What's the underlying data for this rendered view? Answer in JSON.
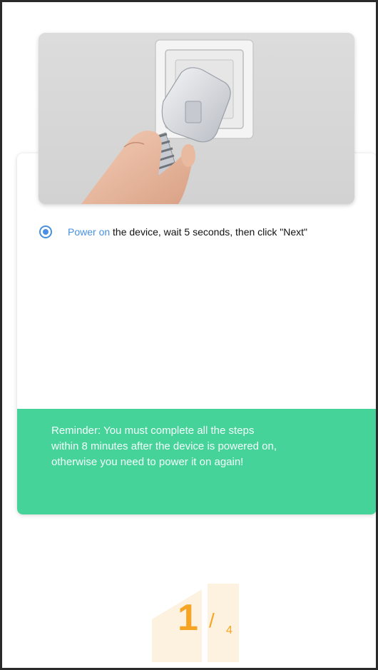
{
  "hero": {
    "image_name": "plug-into-socket-illustration"
  },
  "step": {
    "highlight": "Power on",
    "text": " the device, wait 5 seconds, then click \"Next\"",
    "selected": true
  },
  "reminder": {
    "text": "Reminder: You must complete all the steps\nwithin 8 minutes after the device is powered on,\notherwise you need  to power it on again!"
  },
  "pager": {
    "current": "1",
    "separator": "/",
    "total": "4"
  },
  "colors": {
    "accent": "#4a90e2",
    "reminder_bg": "#45d39a",
    "pager": "#f5a523"
  }
}
